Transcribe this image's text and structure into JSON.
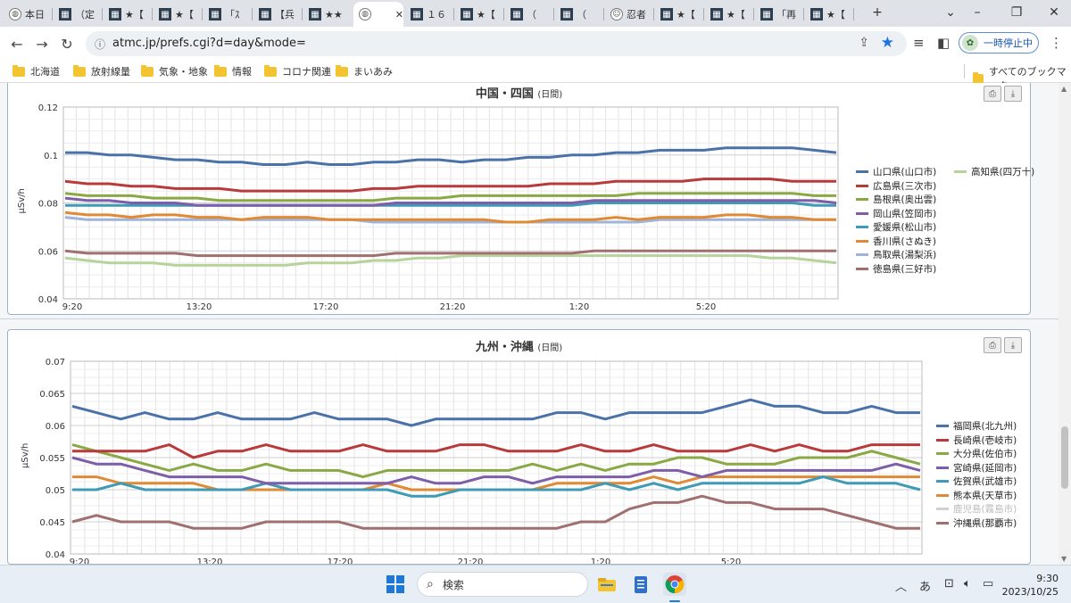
{
  "tabs": [
    {
      "title": "本日",
      "icon": "globe-icon"
    },
    {
      "title": "（定",
      "icon": "site-icon"
    },
    {
      "title": "★【",
      "icon": "site-icon"
    },
    {
      "title": "★【",
      "icon": "site-icon"
    },
    {
      "title": "「ｽ",
      "icon": "site-icon"
    },
    {
      "title": "【兵",
      "icon": "site-icon"
    },
    {
      "title": "★★",
      "icon": "site-icon"
    },
    {
      "title": "",
      "icon": "globe-icon",
      "active": true
    },
    {
      "title": "１６",
      "icon": "site-icon"
    },
    {
      "title": "★【",
      "icon": "site-icon"
    },
    {
      "title": "（",
      "icon": "site-icon"
    },
    {
      "title": "（",
      "icon": "site-icon"
    },
    {
      "title": "忍者",
      "icon": "ninja-icon"
    },
    {
      "title": "★【",
      "icon": "site-icon"
    },
    {
      "title": "★【",
      "icon": "site-icon"
    },
    {
      "title": "「再",
      "icon": "site-icon"
    },
    {
      "title": "★【",
      "icon": "site-icon"
    }
  ],
  "toolbar": {
    "url": "atmc.jp/prefs.cgi?d=day&mode=",
    "pause_label": "一時停止中"
  },
  "bookmarks": {
    "items": [
      "北海道",
      "放射線量",
      "気象・地象",
      "情報",
      "コロナ関連",
      "まいあみ"
    ],
    "all_label": "すべてのブックマーク"
  },
  "panels": [
    {
      "title": "中国・四国",
      "subtitle": "(日間)",
      "chart_data": {
        "type": "line",
        "ylabel": "μSv/h",
        "ylim": [
          0.04,
          0.12
        ],
        "yticks": [
          "0.12",
          "0.1",
          "0.08",
          "0.06",
          "0.04"
        ],
        "xticks": [
          "9:20",
          "13:20",
          "17:20",
          "21:20",
          "1:20",
          "5:20"
        ],
        "grid": true,
        "legend_position": "right",
        "series": [
          {
            "name": "山口県(山口市)",
            "color": "#4a72a8",
            "values": [
              0.101,
              0.101,
              0.1,
              0.1,
              0.099,
              0.098,
              0.098,
              0.097,
              0.097,
              0.096,
              0.096,
              0.097,
              0.096,
              0.096,
              0.097,
              0.097,
              0.098,
              0.098,
              0.097,
              0.098,
              0.098,
              0.099,
              0.099,
              0.1,
              0.1,
              0.101,
              0.101,
              0.102,
              0.102,
              0.102,
              0.103,
              0.103,
              0.103,
              0.103,
              0.102,
              0.101
            ]
          },
          {
            "name": "広島県(三次市)",
            "color": "#b83a3a",
            "values": [
              0.089,
              0.088,
              0.088,
              0.087,
              0.087,
              0.086,
              0.086,
              0.086,
              0.085,
              0.085,
              0.085,
              0.085,
              0.085,
              0.085,
              0.086,
              0.086,
              0.087,
              0.087,
              0.087,
              0.087,
              0.087,
              0.087,
              0.088,
              0.088,
              0.088,
              0.089,
              0.089,
              0.089,
              0.089,
              0.09,
              0.09,
              0.09,
              0.09,
              0.089,
              0.089,
              0.089
            ]
          },
          {
            "name": "島根県(奥出雲)",
            "color": "#8aa945",
            "values": [
              0.084,
              0.083,
              0.083,
              0.083,
              0.082,
              0.082,
              0.082,
              0.081,
              0.081,
              0.081,
              0.081,
              0.081,
              0.081,
              0.081,
              0.081,
              0.082,
              0.082,
              0.082,
              0.083,
              0.083,
              0.083,
              0.083,
              0.083,
              0.083,
              0.083,
              0.083,
              0.084,
              0.084,
              0.084,
              0.084,
              0.084,
              0.084,
              0.084,
              0.084,
              0.083,
              0.083
            ]
          },
          {
            "name": "岡山県(笠岡市)",
            "color": "#7e5ea8",
            "values": [
              0.082,
              0.081,
              0.081,
              0.08,
              0.08,
              0.08,
              0.079,
              0.079,
              0.079,
              0.079,
              0.079,
              0.079,
              0.079,
              0.079,
              0.079,
              0.08,
              0.08,
              0.08,
              0.08,
              0.08,
              0.08,
              0.08,
              0.08,
              0.08,
              0.081,
              0.081,
              0.081,
              0.081,
              0.081,
              0.081,
              0.081,
              0.081,
              0.081,
              0.081,
              0.081,
              0.08
            ]
          },
          {
            "name": "愛媛県(松山市)",
            "color": "#3f9ab5",
            "values": [
              0.079,
              0.079,
              0.079,
              0.079,
              0.079,
              0.079,
              0.079,
              0.079,
              0.079,
              0.079,
              0.079,
              0.079,
              0.079,
              0.079,
              0.079,
              0.079,
              0.079,
              0.079,
              0.079,
              0.079,
              0.079,
              0.079,
              0.079,
              0.079,
              0.08,
              0.08,
              0.08,
              0.08,
              0.08,
              0.08,
              0.08,
              0.08,
              0.08,
              0.08,
              0.079,
              0.079
            ]
          },
          {
            "name": "香川県(さぬき)",
            "color": "#e08a35",
            "values": [
              0.076,
              0.075,
              0.075,
              0.074,
              0.075,
              0.075,
              0.074,
              0.074,
              0.073,
              0.074,
              0.074,
              0.074,
              0.073,
              0.073,
              0.073,
              0.073,
              0.073,
              0.073,
              0.073,
              0.073,
              0.072,
              0.072,
              0.073,
              0.073,
              0.073,
              0.074,
              0.073,
              0.074,
              0.074,
              0.074,
              0.075,
              0.075,
              0.074,
              0.074,
              0.073,
              0.073
            ]
          },
          {
            "name": "鳥取県(湯梨浜)",
            "color": "#9fb4d8",
            "values": [
              0.074,
              0.073,
              0.073,
              0.073,
              0.073,
              0.073,
              0.073,
              0.073,
              0.073,
              0.073,
              0.073,
              0.073,
              0.073,
              0.073,
              0.072,
              0.072,
              0.072,
              0.072,
              0.072,
              0.072,
              0.072,
              0.072,
              0.072,
              0.072,
              0.072,
              0.072,
              0.072,
              0.073,
              0.073,
              0.073,
              0.073,
              0.073,
              0.073,
              0.073,
              0.073,
              0.073
            ]
          },
          {
            "name": "徳島県(三好市)",
            "color": "#a07070",
            "values": [
              0.06,
              0.059,
              0.059,
              0.059,
              0.059,
              0.059,
              0.058,
              0.058,
              0.058,
              0.058,
              0.058,
              0.058,
              0.058,
              0.058,
              0.058,
              0.059,
              0.059,
              0.059,
              0.059,
              0.059,
              0.059,
              0.059,
              0.059,
              0.059,
              0.06,
              0.06,
              0.06,
              0.06,
              0.06,
              0.06,
              0.06,
              0.06,
              0.06,
              0.06,
              0.06,
              0.06
            ]
          },
          {
            "name": "高知県(四万十)",
            "color": "#b5d39a",
            "values": [
              0.057,
              0.056,
              0.055,
              0.055,
              0.055,
              0.054,
              0.054,
              0.054,
              0.054,
              0.054,
              0.054,
              0.055,
              0.055,
              0.055,
              0.056,
              0.056,
              0.057,
              0.057,
              0.058,
              0.058,
              0.058,
              0.058,
              0.058,
              0.058,
              0.058,
              0.058,
              0.058,
              0.058,
              0.058,
              0.058,
              0.058,
              0.058,
              0.057,
              0.057,
              0.056,
              0.055
            ]
          }
        ]
      }
    },
    {
      "title": "九州・沖縄",
      "subtitle": "(日間)",
      "chart_data": {
        "type": "line",
        "ylabel": "μSv/h",
        "ylim": [
          0.04,
          0.07
        ],
        "yticks": [
          "0.07",
          "0.065",
          "0.06",
          "0.055",
          "0.05",
          "0.045",
          "0.04"
        ],
        "xticks": [
          "9:20",
          "13:20",
          "17:20",
          "21:20",
          "1:20",
          "5:20"
        ],
        "grid": true,
        "legend_position": "right",
        "series": [
          {
            "name": "福岡県(北九州)",
            "color": "#4a72a8",
            "values": [
              0.063,
              0.062,
              0.061,
              0.062,
              0.061,
              0.061,
              0.062,
              0.061,
              0.061,
              0.061,
              0.062,
              0.061,
              0.061,
              0.061,
              0.06,
              0.061,
              0.061,
              0.061,
              0.061,
              0.061,
              0.062,
              0.062,
              0.061,
              0.062,
              0.062,
              0.062,
              0.062,
              0.063,
              0.064,
              0.063,
              0.063,
              0.062,
              0.062,
              0.063,
              0.062,
              0.062
            ]
          },
          {
            "name": "長崎県(壱岐市)",
            "color": "#b83a3a",
            "values": [
              0.056,
              0.056,
              0.056,
              0.056,
              0.057,
              0.055,
              0.056,
              0.056,
              0.057,
              0.056,
              0.056,
              0.056,
              0.057,
              0.056,
              0.056,
              0.056,
              0.057,
              0.057,
              0.056,
              0.056,
              0.056,
              0.057,
              0.056,
              0.056,
              0.057,
              0.056,
              0.056,
              0.056,
              0.057,
              0.056,
              0.057,
              0.056,
              0.056,
              0.057,
              0.057,
              0.057
            ]
          },
          {
            "name": "大分県(佐伯市)",
            "color": "#8aa945",
            "values": [
              0.057,
              0.056,
              0.055,
              0.054,
              0.053,
              0.054,
              0.053,
              0.053,
              0.054,
              0.053,
              0.053,
              0.053,
              0.052,
              0.053,
              0.053,
              0.053,
              0.053,
              0.053,
              0.053,
              0.054,
              0.053,
              0.054,
              0.053,
              0.054,
              0.054,
              0.055,
              0.055,
              0.054,
              0.054,
              0.054,
              0.055,
              0.055,
              0.055,
              0.056,
              0.055,
              0.054
            ]
          },
          {
            "name": "宮崎県(延岡市)",
            "color": "#7e5ea8",
            "values": [
              0.055,
              0.054,
              0.054,
              0.053,
              0.052,
              0.052,
              0.052,
              0.052,
              0.051,
              0.051,
              0.051,
              0.051,
              0.051,
              0.051,
              0.052,
              0.051,
              0.051,
              0.052,
              0.052,
              0.051,
              0.052,
              0.052,
              0.052,
              0.052,
              0.053,
              0.053,
              0.052,
              0.053,
              0.053,
              0.053,
              0.053,
              0.053,
              0.053,
              0.053,
              0.054,
              0.053
            ]
          },
          {
            "name": "佐賀県(武雄市)",
            "color": "#3f9ab5",
            "values": [
              0.05,
              0.05,
              0.051,
              0.05,
              0.05,
              0.05,
              0.05,
              0.05,
              0.051,
              0.05,
              0.05,
              0.05,
              0.05,
              0.05,
              0.049,
              0.049,
              0.05,
              0.05,
              0.05,
              0.05,
              0.05,
              0.05,
              0.051,
              0.05,
              0.051,
              0.05,
              0.051,
              0.051,
              0.051,
              0.051,
              0.051,
              0.052,
              0.051,
              0.051,
              0.051,
              0.05
            ]
          },
          {
            "name": "熊本県(天草市)",
            "color": "#e08a35",
            "values": [
              0.052,
              0.052,
              0.051,
              0.051,
              0.051,
              0.051,
              0.05,
              0.05,
              0.05,
              0.05,
              0.05,
              0.05,
              0.05,
              0.051,
              0.05,
              0.05,
              0.05,
              0.05,
              0.05,
              0.05,
              0.051,
              0.051,
              0.051,
              0.051,
              0.052,
              0.051,
              0.052,
              0.052,
              0.052,
              0.052,
              0.052,
              0.052,
              0.052,
              0.052,
              0.052,
              0.052
            ]
          },
          {
            "name": "鹿児島(霧島市)",
            "color": "#d0d0d0",
            "faded": true,
            "values": []
          },
          {
            "name": "沖縄県(那覇市)",
            "color": "#a07070",
            "values": [
              0.045,
              0.046,
              0.045,
              0.045,
              0.045,
              0.044,
              0.044,
              0.044,
              0.045,
              0.045,
              0.045,
              0.045,
              0.044,
              0.044,
              0.044,
              0.044,
              0.044,
              0.044,
              0.044,
              0.044,
              0.044,
              0.045,
              0.045,
              0.047,
              0.048,
              0.048,
              0.049,
              0.048,
              0.048,
              0.047,
              0.047,
              0.047,
              0.046,
              0.045,
              0.044,
              0.044
            ]
          }
        ]
      }
    }
  ],
  "taskbar": {
    "search_label": "検索",
    "ime": "あ",
    "time": "9:30",
    "date": "2023/10/25"
  }
}
